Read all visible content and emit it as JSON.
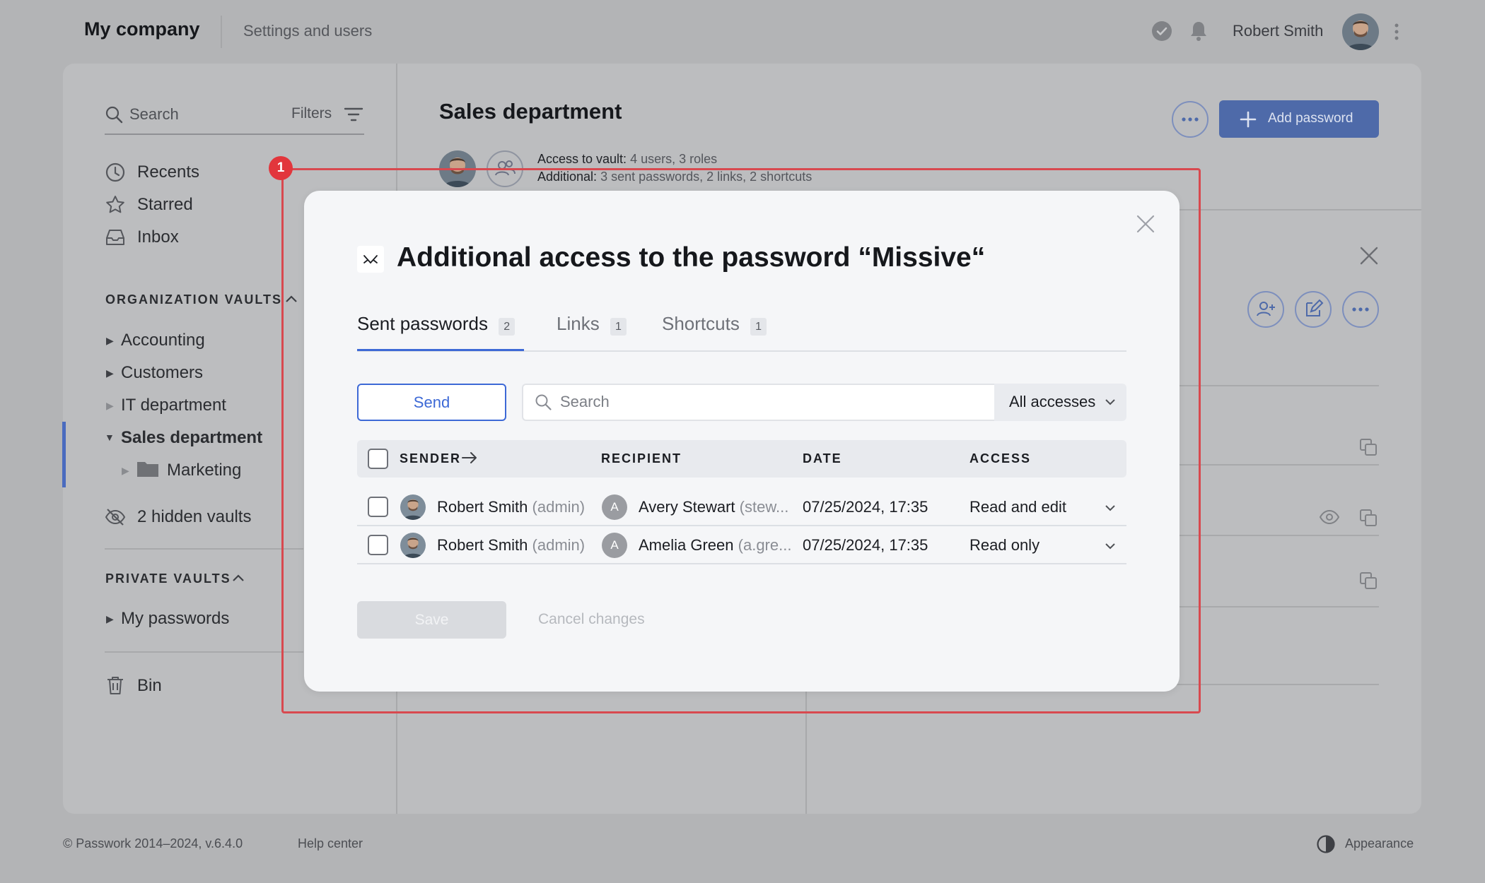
{
  "topbar": {
    "company": "My company",
    "section": "Settings and users",
    "user_name": "Robert Smith"
  },
  "sidebar": {
    "search_placeholder": "Search",
    "filters_label": "Filters",
    "quick": [
      "Recents",
      "Starred",
      "Inbox"
    ],
    "org_section": "ORGANIZATION VAULTS",
    "org_vaults": [
      "Accounting",
      "Customers",
      "IT department",
      "Sales department",
      "Marketing"
    ],
    "hidden_vaults": "2 hidden vaults",
    "private_section": "PRIVATE VAULTS",
    "private_vaults": [
      "My passwords"
    ],
    "bin": "Bin"
  },
  "main": {
    "title": "Sales department",
    "add_password": "Add password",
    "access_label": "Access to vault:",
    "access_value": "4 users, 3 roles",
    "additional_label": "Additional:",
    "additional_value": "3 sent passwords, 2 links, 2 shortcuts"
  },
  "highlight": {
    "badge": "1"
  },
  "modal": {
    "title": "Additional access to the password “Missive“",
    "tabs": [
      {
        "label": "Sent passwords",
        "count": "2"
      },
      {
        "label": "Links",
        "count": "1"
      },
      {
        "label": "Shortcuts",
        "count": "1"
      }
    ],
    "send_label": "Send",
    "search_placeholder": "Search",
    "filter_value": "All accesses",
    "columns": [
      "SENDER",
      "RECIPIENT",
      "DATE",
      "ACCESS"
    ],
    "rows": [
      {
        "sender": "Robert Smith",
        "sender_role": "(admin)",
        "recipient_initial": "A",
        "recipient": "Avery Stewart",
        "recipient_login": "(stew...",
        "date": "07/25/2024, 17:35",
        "access": "Read and edit"
      },
      {
        "sender": "Robert Smith",
        "sender_role": "(admin)",
        "recipient_initial": "A",
        "recipient": "Amelia Green",
        "recipient_login": "(a.gre...",
        "date": "07/25/2024, 17:35",
        "access": "Read only"
      }
    ],
    "save_label": "Save",
    "cancel_label": "Cancel changes"
  },
  "footer": {
    "copyright": "© Passwork 2014–2024, v.6.4.0",
    "help": "Help center",
    "appearance": "Appearance"
  },
  "colors": {
    "accent": "#3d69d6",
    "highlight": "#d8494f",
    "overlay": "#b3b4b6"
  }
}
